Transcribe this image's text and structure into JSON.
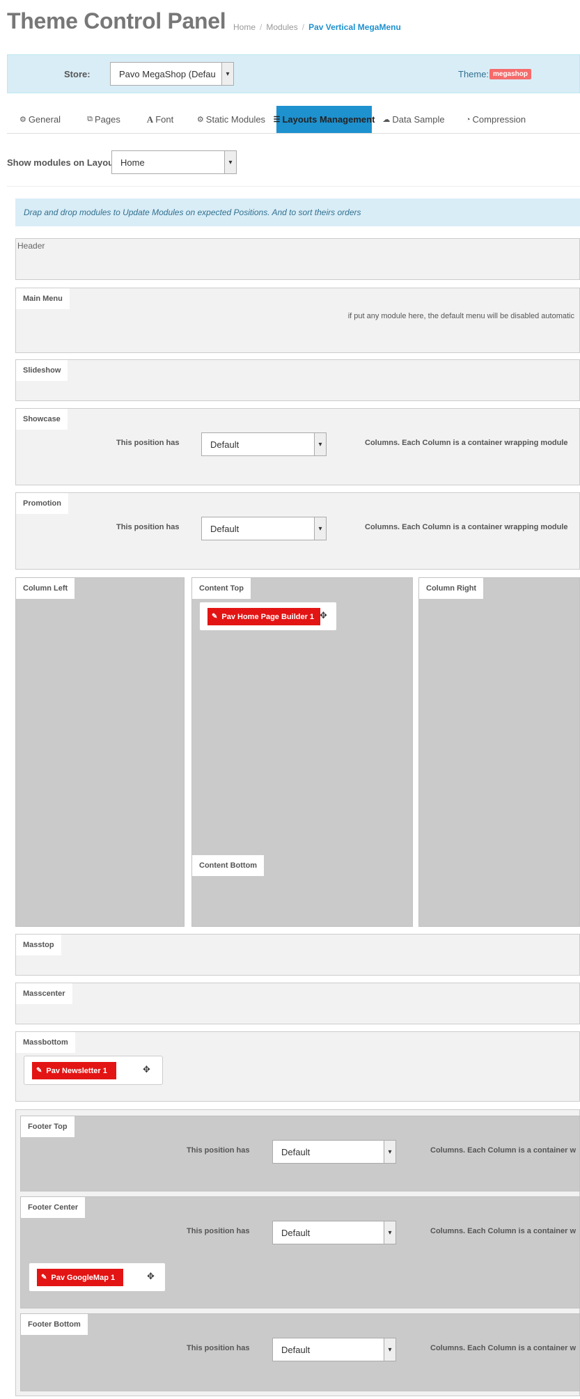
{
  "header": {
    "title": "Theme Control Panel",
    "breadcrumb": [
      "Home",
      "Modules",
      "Pav Vertical MegaMenu"
    ]
  },
  "store_bar": {
    "store_label": "Store:",
    "store_value": "Pavo MegaShop (Defau",
    "theme_label": "Theme:",
    "theme_badge": "megashop"
  },
  "tabs": [
    {
      "label": "General",
      "icon": "gear-icon"
    },
    {
      "label": "Pages",
      "icon": "pages-icon"
    },
    {
      "label": "Font",
      "icon": "font-icon"
    },
    {
      "label": "Static Modules",
      "icon": "cogs-icon"
    },
    {
      "label": "Layouts Management",
      "icon": "list-icon",
      "active": true
    },
    {
      "label": "Data Sample",
      "icon": "cloud-download-icon"
    },
    {
      "label": "Compression",
      "icon": "dashboard-icon"
    }
  ],
  "layout_select": {
    "label": "Show modules on Layout",
    "value": "Home"
  },
  "info_message": "Drap and drop modules to Update Modules on expected Positions. And to sort theirs orders",
  "positions": {
    "header": "Header",
    "mainmenu": {
      "title": "Main Menu",
      "note": "if put any module here, the default menu will be disabled automatic"
    },
    "slideshow": "Slideshow",
    "showcase": {
      "title": "Showcase",
      "has_label": "This position has",
      "value": "Default",
      "suffix": "Columns. Each Column is a container wrapping module"
    },
    "promotion": {
      "title": "Promotion",
      "has_label": "This position has",
      "value": "Default",
      "suffix": "Columns. Each Column is a container wrapping module"
    },
    "column_left": "Column Left",
    "content_top": {
      "title": "Content Top",
      "module": "Pav Home Page Builder 1"
    },
    "column_right": "Column Right",
    "content_bottom": "Content Bottom",
    "masstop": "Masstop",
    "masscenter": "Masscenter",
    "massbottom": {
      "title": "Massbottom",
      "module": "Pav Newsletter 1"
    },
    "footer_top": {
      "title": "Footer Top",
      "has_label": "This position has",
      "value": "Default",
      "suffix": "Columns. Each Column is a container w"
    },
    "footer_center": {
      "title": "Footer Center",
      "has_label": "This position has",
      "value": "Default",
      "suffix": "Columns. Each Column is a container w",
      "module": "Pav GoogleMap 1"
    },
    "footer_bottom": {
      "title": "Footer Bottom",
      "has_label": "This position has",
      "value": "Default",
      "suffix": "Columns. Each Column is a container w"
    }
  },
  "colors": {
    "accent": "#1e91cf",
    "module_button": "#e31414",
    "badge": "#f56b6b",
    "info_bg": "#d9edf7"
  }
}
